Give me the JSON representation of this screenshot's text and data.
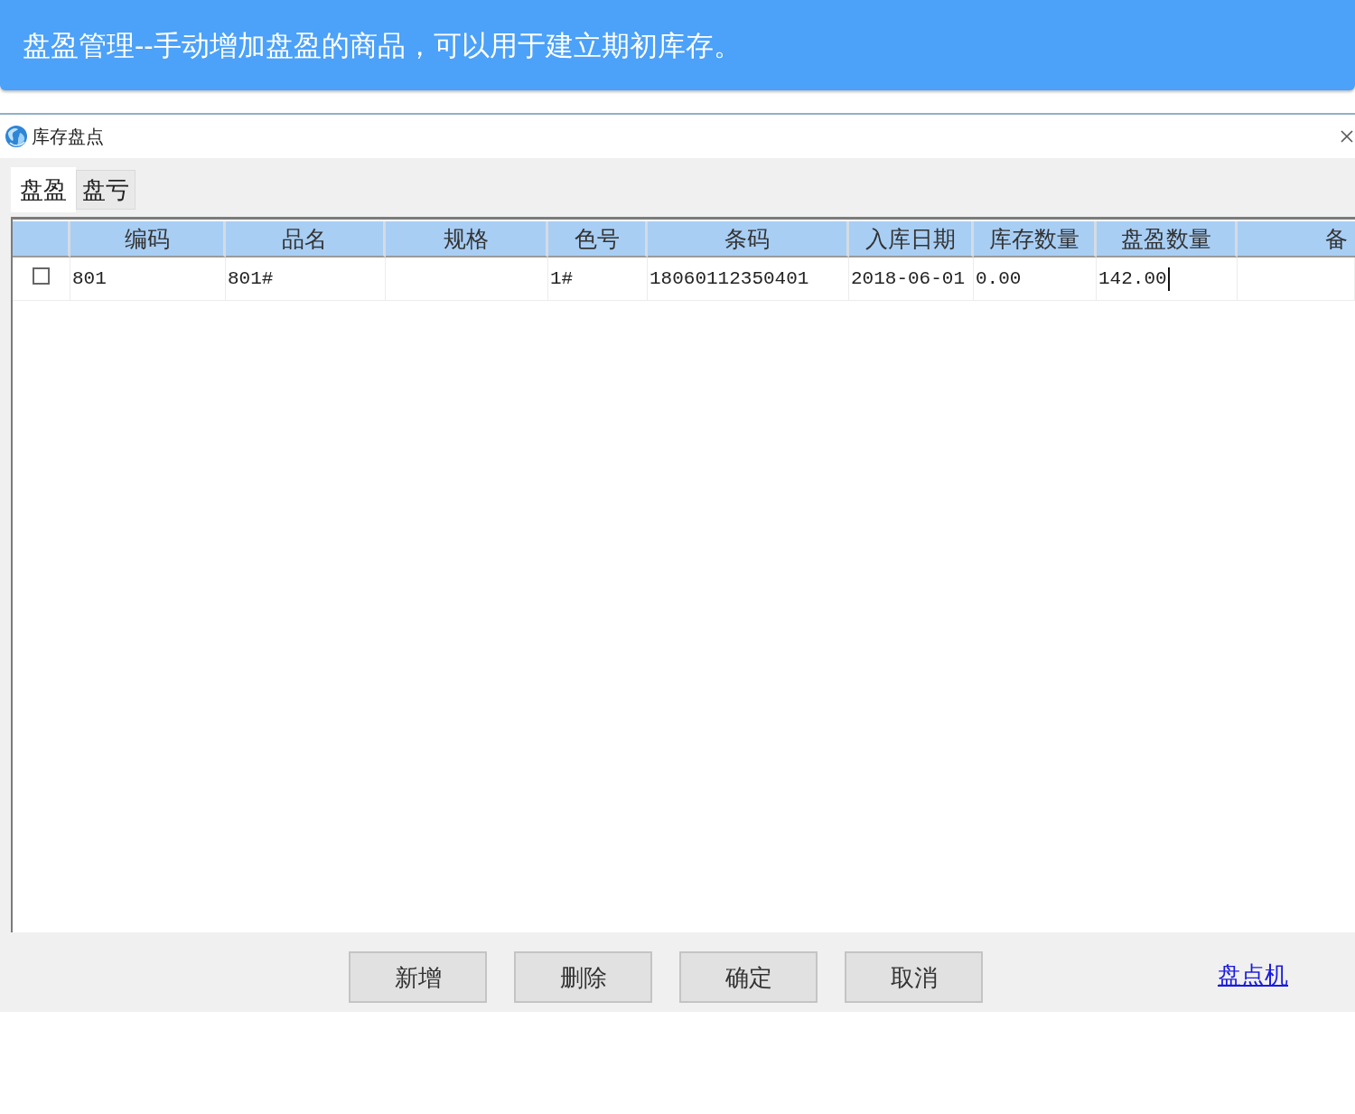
{
  "banner": {
    "text": "盘盈管理--手动增加盘盈的商品，可以用于建立期初库存。"
  },
  "window": {
    "title": "库存盘点"
  },
  "tabs": [
    {
      "label": "盘盈",
      "selected": true
    },
    {
      "label": "盘亏",
      "selected": false
    }
  ],
  "grid": {
    "columns": [
      "编码",
      "品名",
      "规格",
      "色号",
      "条码",
      "入库日期",
      "库存数量",
      "盘盈数量",
      "备"
    ],
    "rows": [
      {
        "checked": false,
        "cells": [
          {
            "text": "801"
          },
          {
            "text": "801#"
          },
          {},
          {
            "text": "1#"
          },
          {
            "text": "18060112350401"
          },
          {
            "text": "2018-06-01"
          },
          {
            "text": "0.00"
          },
          {
            "text": "142.00",
            "editing": true
          },
          {}
        ]
      }
    ]
  },
  "buttons": [
    "新增",
    "删除",
    "确定",
    "取消"
  ],
  "link": "盘点机"
}
